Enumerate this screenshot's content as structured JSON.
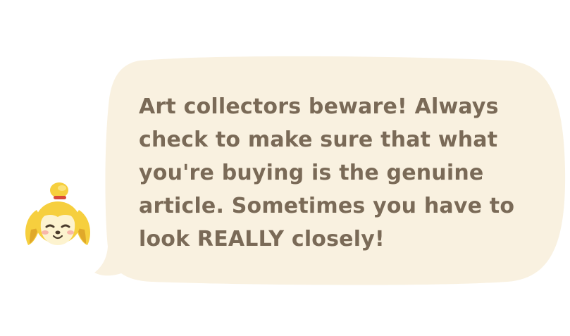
{
  "dialog": {
    "speaker_icon": "dog-character-icon",
    "message": "Art collectors beware! Always\ncheck to make sure that what\nyou're buying is the genuine\narticle. Sometimes you have to\nlook REALLY closely!"
  },
  "colors": {
    "bubble": "#f9f1e0",
    "text": "#7a6a57",
    "fur": "#f6cf3e",
    "fur_shadow": "#e0a82a",
    "face": "#fdf3cf",
    "blush": "#f6a7a0",
    "hair_tie": "#d94a3a"
  }
}
